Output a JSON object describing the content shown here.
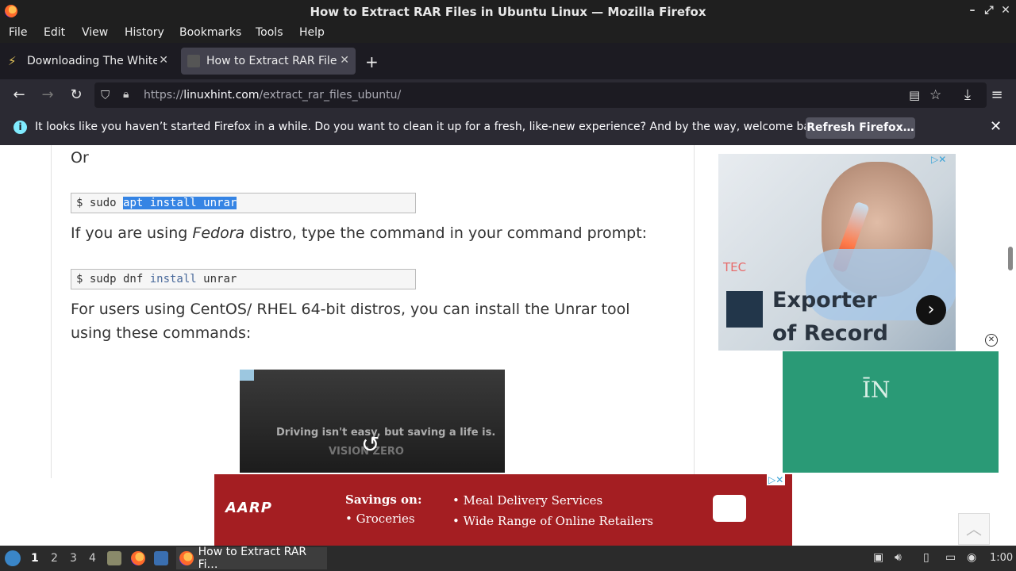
{
  "window": {
    "title": "How to Extract RAR Files in Ubuntu Linux — Mozilla Firefox"
  },
  "menu": [
    "File",
    "Edit",
    "View",
    "History",
    "Bookmarks",
    "Tools",
    "Help"
  ],
  "tabs": [
    {
      "label": "Downloading The White Ho"
    },
    {
      "label": "How to Extract RAR Files"
    }
  ],
  "url": {
    "prefix": "https://",
    "domain": "linuxhint.com",
    "path": "/extract_rar_files_ubuntu/"
  },
  "notification": {
    "message": "It looks like you haven’t started Firefox in a while. Do you want to clean it up for a fresh, like-new experience? And by the way, welcome back!",
    "button": "Refresh Firefox…"
  },
  "article": {
    "or": "Or",
    "cmd1_prefix": "$ sudo ",
    "cmd1_selected": "apt install unrar",
    "fedora_a": "If you are using ",
    "fedora_em": "Fedora",
    "fedora_b": " distro, type the command in your command prompt:",
    "cmd2_a": "$ sudp dnf ",
    "cmd2_kw": "install",
    "cmd2_b": " unrar",
    "centos": "For users using CentOS/ RHEL 64-bit distros, you can install the Unrar tool using these commands:",
    "video_text": "Driving isn't easy, but saving a life is.",
    "video_text2": "VISION ZERO"
  },
  "ads": {
    "tec": "TEC",
    "exporter": "Exporter of Record",
    "in_logo": "ĪN",
    "aarp_logo": "AARP",
    "savings": "Savings on:",
    "b1": "• Groceries",
    "b2": "• Meal Delivery Services",
    "b3": "• Wide Range of Online Retailers"
  },
  "taskbar": {
    "workspaces": [
      "1",
      "2",
      "3",
      "4"
    ],
    "task": "How to Extract RAR Fi…",
    "clock": "1:00"
  }
}
